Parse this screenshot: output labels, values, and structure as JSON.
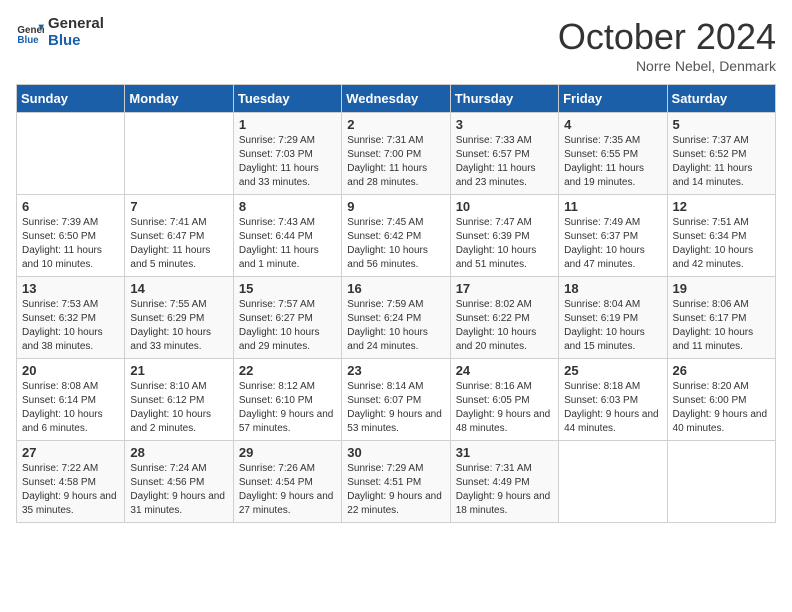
{
  "header": {
    "logo_line1": "General",
    "logo_line2": "Blue",
    "month": "October 2024",
    "location": "Norre Nebel, Denmark"
  },
  "days_of_week": [
    "Sunday",
    "Monday",
    "Tuesday",
    "Wednesday",
    "Thursday",
    "Friday",
    "Saturday"
  ],
  "weeks": [
    [
      {
        "day": "",
        "sunrise": "",
        "sunset": "",
        "daylight": ""
      },
      {
        "day": "",
        "sunrise": "",
        "sunset": "",
        "daylight": ""
      },
      {
        "day": "1",
        "sunrise": "Sunrise: 7:29 AM",
        "sunset": "Sunset: 7:03 PM",
        "daylight": "Daylight: 11 hours and 33 minutes."
      },
      {
        "day": "2",
        "sunrise": "Sunrise: 7:31 AM",
        "sunset": "Sunset: 7:00 PM",
        "daylight": "Daylight: 11 hours and 28 minutes."
      },
      {
        "day": "3",
        "sunrise": "Sunrise: 7:33 AM",
        "sunset": "Sunset: 6:57 PM",
        "daylight": "Daylight: 11 hours and 23 minutes."
      },
      {
        "day": "4",
        "sunrise": "Sunrise: 7:35 AM",
        "sunset": "Sunset: 6:55 PM",
        "daylight": "Daylight: 11 hours and 19 minutes."
      },
      {
        "day": "5",
        "sunrise": "Sunrise: 7:37 AM",
        "sunset": "Sunset: 6:52 PM",
        "daylight": "Daylight: 11 hours and 14 minutes."
      }
    ],
    [
      {
        "day": "6",
        "sunrise": "Sunrise: 7:39 AM",
        "sunset": "Sunset: 6:50 PM",
        "daylight": "Daylight: 11 hours and 10 minutes."
      },
      {
        "day": "7",
        "sunrise": "Sunrise: 7:41 AM",
        "sunset": "Sunset: 6:47 PM",
        "daylight": "Daylight: 11 hours and 5 minutes."
      },
      {
        "day": "8",
        "sunrise": "Sunrise: 7:43 AM",
        "sunset": "Sunset: 6:44 PM",
        "daylight": "Daylight: 11 hours and 1 minute."
      },
      {
        "day": "9",
        "sunrise": "Sunrise: 7:45 AM",
        "sunset": "Sunset: 6:42 PM",
        "daylight": "Daylight: 10 hours and 56 minutes."
      },
      {
        "day": "10",
        "sunrise": "Sunrise: 7:47 AM",
        "sunset": "Sunset: 6:39 PM",
        "daylight": "Daylight: 10 hours and 51 minutes."
      },
      {
        "day": "11",
        "sunrise": "Sunrise: 7:49 AM",
        "sunset": "Sunset: 6:37 PM",
        "daylight": "Daylight: 10 hours and 47 minutes."
      },
      {
        "day": "12",
        "sunrise": "Sunrise: 7:51 AM",
        "sunset": "Sunset: 6:34 PM",
        "daylight": "Daylight: 10 hours and 42 minutes."
      }
    ],
    [
      {
        "day": "13",
        "sunrise": "Sunrise: 7:53 AM",
        "sunset": "Sunset: 6:32 PM",
        "daylight": "Daylight: 10 hours and 38 minutes."
      },
      {
        "day": "14",
        "sunrise": "Sunrise: 7:55 AM",
        "sunset": "Sunset: 6:29 PM",
        "daylight": "Daylight: 10 hours and 33 minutes."
      },
      {
        "day": "15",
        "sunrise": "Sunrise: 7:57 AM",
        "sunset": "Sunset: 6:27 PM",
        "daylight": "Daylight: 10 hours and 29 minutes."
      },
      {
        "day": "16",
        "sunrise": "Sunrise: 7:59 AM",
        "sunset": "Sunset: 6:24 PM",
        "daylight": "Daylight: 10 hours and 24 minutes."
      },
      {
        "day": "17",
        "sunrise": "Sunrise: 8:02 AM",
        "sunset": "Sunset: 6:22 PM",
        "daylight": "Daylight: 10 hours and 20 minutes."
      },
      {
        "day": "18",
        "sunrise": "Sunrise: 8:04 AM",
        "sunset": "Sunset: 6:19 PM",
        "daylight": "Daylight: 10 hours and 15 minutes."
      },
      {
        "day": "19",
        "sunrise": "Sunrise: 8:06 AM",
        "sunset": "Sunset: 6:17 PM",
        "daylight": "Daylight: 10 hours and 11 minutes."
      }
    ],
    [
      {
        "day": "20",
        "sunrise": "Sunrise: 8:08 AM",
        "sunset": "Sunset: 6:14 PM",
        "daylight": "Daylight: 10 hours and 6 minutes."
      },
      {
        "day": "21",
        "sunrise": "Sunrise: 8:10 AM",
        "sunset": "Sunset: 6:12 PM",
        "daylight": "Daylight: 10 hours and 2 minutes."
      },
      {
        "day": "22",
        "sunrise": "Sunrise: 8:12 AM",
        "sunset": "Sunset: 6:10 PM",
        "daylight": "Daylight: 9 hours and 57 minutes."
      },
      {
        "day": "23",
        "sunrise": "Sunrise: 8:14 AM",
        "sunset": "Sunset: 6:07 PM",
        "daylight": "Daylight: 9 hours and 53 minutes."
      },
      {
        "day": "24",
        "sunrise": "Sunrise: 8:16 AM",
        "sunset": "Sunset: 6:05 PM",
        "daylight": "Daylight: 9 hours and 48 minutes."
      },
      {
        "day": "25",
        "sunrise": "Sunrise: 8:18 AM",
        "sunset": "Sunset: 6:03 PM",
        "daylight": "Daylight: 9 hours and 44 minutes."
      },
      {
        "day": "26",
        "sunrise": "Sunrise: 8:20 AM",
        "sunset": "Sunset: 6:00 PM",
        "daylight": "Daylight: 9 hours and 40 minutes."
      }
    ],
    [
      {
        "day": "27",
        "sunrise": "Sunrise: 7:22 AM",
        "sunset": "Sunset: 4:58 PM",
        "daylight": "Daylight: 9 hours and 35 minutes."
      },
      {
        "day": "28",
        "sunrise": "Sunrise: 7:24 AM",
        "sunset": "Sunset: 4:56 PM",
        "daylight": "Daylight: 9 hours and 31 minutes."
      },
      {
        "day": "29",
        "sunrise": "Sunrise: 7:26 AM",
        "sunset": "Sunset: 4:54 PM",
        "daylight": "Daylight: 9 hours and 27 minutes."
      },
      {
        "day": "30",
        "sunrise": "Sunrise: 7:29 AM",
        "sunset": "Sunset: 4:51 PM",
        "daylight": "Daylight: 9 hours and 22 minutes."
      },
      {
        "day": "31",
        "sunrise": "Sunrise: 7:31 AM",
        "sunset": "Sunset: 4:49 PM",
        "daylight": "Daylight: 9 hours and 18 minutes."
      },
      {
        "day": "",
        "sunrise": "",
        "sunset": "",
        "daylight": ""
      },
      {
        "day": "",
        "sunrise": "",
        "sunset": "",
        "daylight": ""
      }
    ]
  ]
}
